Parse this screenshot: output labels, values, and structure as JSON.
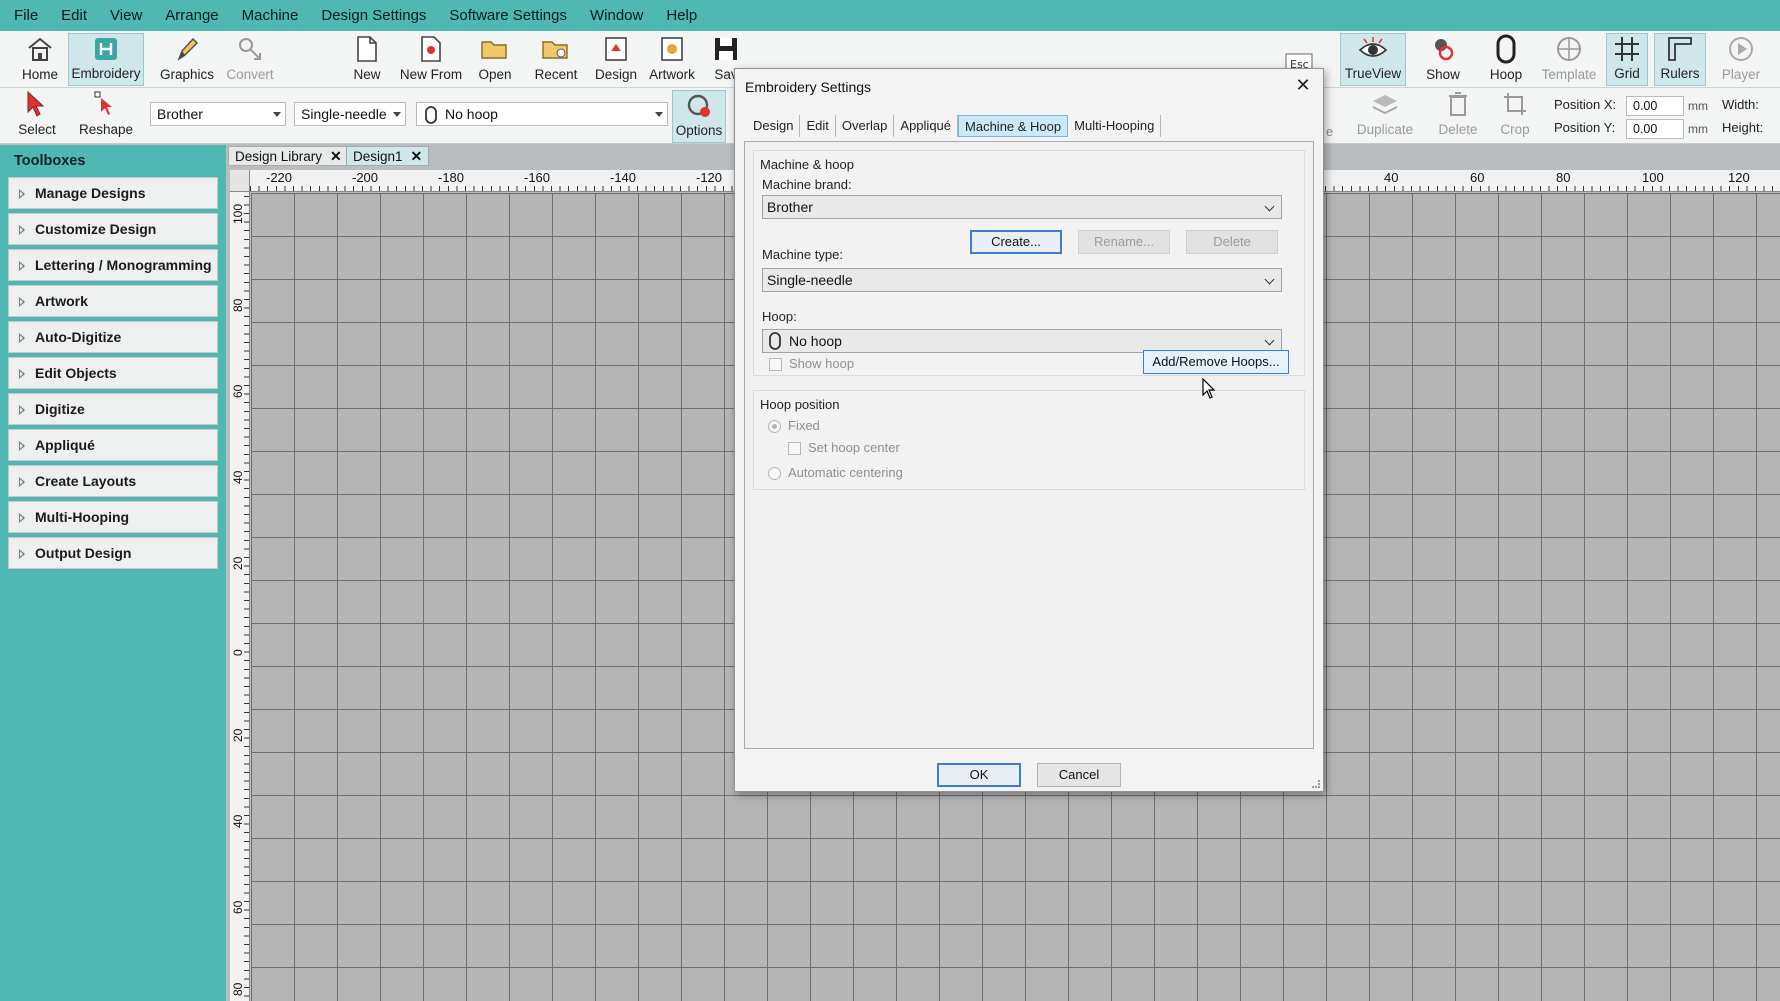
{
  "menu": [
    "File",
    "Edit",
    "View",
    "Arrange",
    "Machine",
    "Design Settings",
    "Software Settings",
    "Window",
    "Help"
  ],
  "ribbon": {
    "home": "Home",
    "embroidery": "Embroidery",
    "graphics": "Graphics",
    "convert": "Convert",
    "new": "New",
    "new_from": "New From",
    "open": "Open",
    "recent": "Recent",
    "design": "Design",
    "artwork": "Artwork",
    "save": "Sav",
    "esc": "Esc",
    "trueview": "TrueView",
    "show": "Show",
    "hoop": "Hoop",
    "template": "Template",
    "grid": "Grid",
    "rulers": "Rulers",
    "player": "Player"
  },
  "toolbar2": {
    "select": "Select",
    "reshape": "Reshape",
    "brand_value": "Brother",
    "type_value": "Single-needle",
    "hoop_value": "No hoop",
    "options": "Options",
    "duplicate": "Duplicate",
    "delete": "Delete",
    "crop": "Crop",
    "position_x_label": "Position X:",
    "position_y_label": "Position Y:",
    "position_x": "0.00",
    "position_y": "0.00",
    "unit": "mm",
    "width_label": "Width:",
    "height_label": "Height:",
    "e_fragment": "e"
  },
  "doc_tabs": [
    "Design Library",
    "Design1"
  ],
  "toolboxes": {
    "title": "Toolboxes",
    "items": [
      "Manage Designs",
      "Customize Design",
      "Lettering / Monogramming",
      "Artwork",
      "Auto-Digitize",
      "Edit Objects",
      "Digitize",
      "Appliqué",
      "Create Layouts",
      "Multi-Hooping",
      "Output Design"
    ]
  },
  "ruler": {
    "h_left": [
      "-220",
      "-200",
      "-180",
      "-160",
      "-140",
      "-120"
    ],
    "h_right": [
      "40",
      "60",
      "80",
      "100",
      "120"
    ],
    "v": [
      "100",
      "80",
      "60",
      "40",
      "20",
      "0",
      "20",
      "40",
      "60",
      "80"
    ]
  },
  "dialog": {
    "title": "Embroidery Settings",
    "tabs": [
      "Design",
      "Edit",
      "Overlap",
      "Appliqué",
      "Machine & Hoop",
      "Multi-Hooping"
    ],
    "selected_tab": "Machine & Hoop",
    "group_machine_title": "Machine & hoop",
    "machine_brand_label": "Machine brand:",
    "machine_brand_value": "Brother",
    "create_button": "Create...",
    "rename_button": "Rename...",
    "delete_button": "Delete",
    "machine_type_label": "Machine type:",
    "machine_type_value": "Single-needle",
    "hoop_label": "Hoop:",
    "hoop_value": "No hoop",
    "show_hoop_label": "Show hoop",
    "add_remove_button": "Add/Remove Hoops...",
    "group_position_title": "Hoop position",
    "fixed_label": "Fixed",
    "set_center_label": "Set hoop center",
    "auto_center_label": "Automatic centering",
    "ok_button": "OK",
    "cancel_button": "Cancel"
  },
  "colors": {
    "accent_teal": "#4fb8b3",
    "selected_tab": "#cbe8f6",
    "focus_blue": "#3c7dd0"
  }
}
